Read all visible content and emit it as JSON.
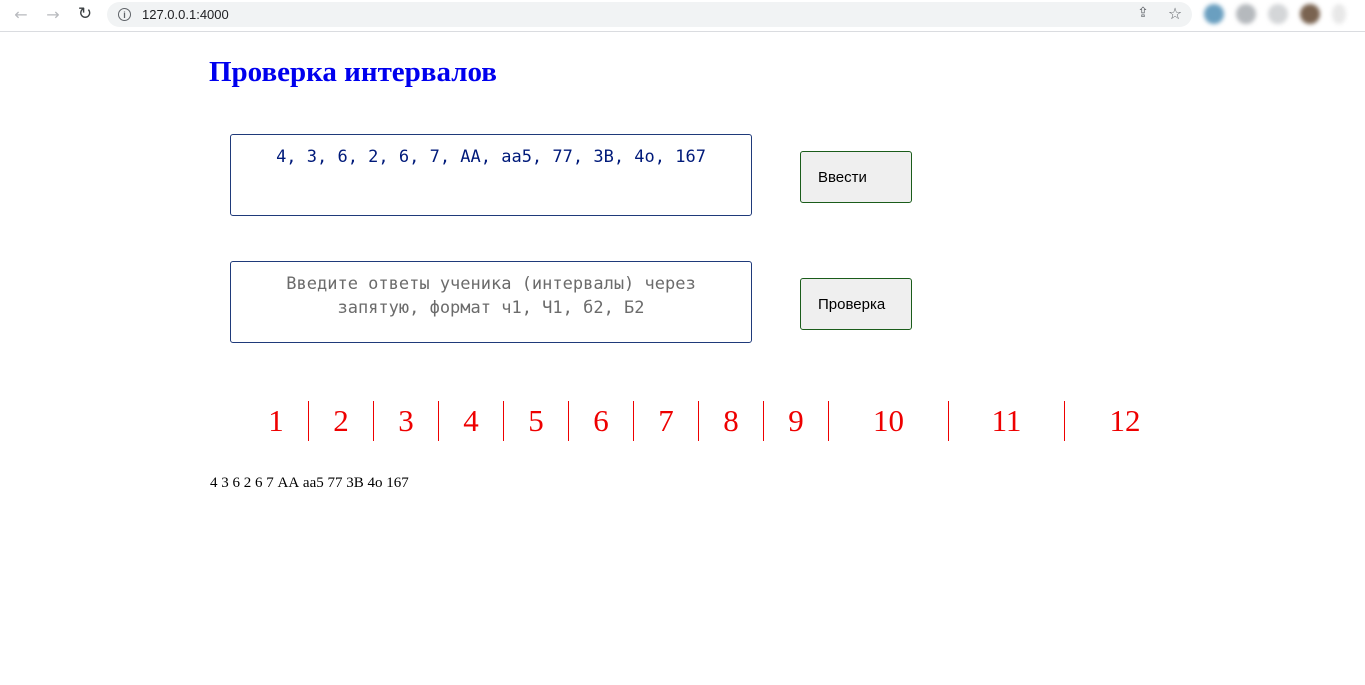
{
  "browser": {
    "url": "127.0.0.1:4000",
    "icons": {
      "back": "arrow-left-icon",
      "forward": "arrow-right-icon",
      "reload": "reload-icon",
      "info": "info-icon",
      "share": "share-icon",
      "bookmark": "star-icon"
    }
  },
  "page": {
    "title": "Проверка интервалов",
    "intervals_input": {
      "value": "4, 3, 6, 2, 6, 7, АА, аа5, 77, 3В, 4о, 167"
    },
    "answers_input": {
      "value": "",
      "placeholder": "Введите ответы ученика (интервалы) через запятую, формат ч1, Ч1, б2, Б2"
    },
    "enter_button_label": "Ввести",
    "check_button_label": "Проверка",
    "numbers": [
      "1",
      "2",
      "3",
      "4",
      "5",
      "6",
      "7",
      "8",
      "9",
      "10",
      "11",
      "12"
    ],
    "output_text": "4 3 6 2 6 7 АА аа5 77 3В 4о 167"
  },
  "colors": {
    "title": "#0000ee",
    "numbers": "#ee0000",
    "input_border": "#1f3a7a",
    "button_border": "#1a5c1a"
  }
}
